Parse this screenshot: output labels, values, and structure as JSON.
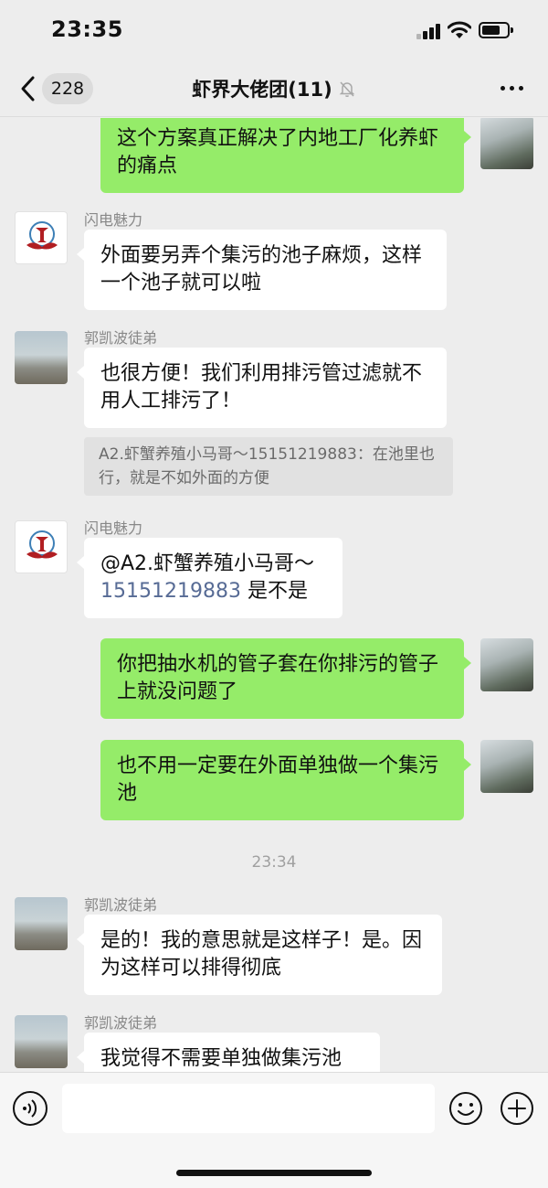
{
  "status_bar": {
    "time": "23:35"
  },
  "nav": {
    "unread_count": "228",
    "title": "虾界大佬团(11)"
  },
  "messages": [
    {
      "direction": "out",
      "text": "这个方案真正解决了内地工厂化养虾的痛点"
    },
    {
      "direction": "in",
      "sender": "闪电魅力",
      "text": "外面要另弄个集污的池子麻烦，这样一个池子就可以啦"
    },
    {
      "direction": "in",
      "sender": "郭凯波徒弟",
      "text": "也很方便！我们利用排污管过滤就不用人工排污了！",
      "quote": "A2.虾蟹养殖小马哥～15151219883：在池里也行，就是不如外面的方便"
    },
    {
      "direction": "in",
      "sender": "闪电魅力",
      "text_prefix": "@A2.虾蟹养殖小马哥～",
      "text_number": "15151219883",
      "text_suffix": " 是不是"
    },
    {
      "direction": "out",
      "text": "你把抽水机的管子套在你排污的管子上就没问题了"
    },
    {
      "direction": "out",
      "text": "也不用一定要在外面单独做一个集污池"
    },
    {
      "divider": "23:34"
    },
    {
      "direction": "in",
      "sender": "郭凯波徒弟",
      "text": "是的！我的意思就是这样子！是。因为这样可以排得彻底"
    },
    {
      "direction": "in",
      "sender": "郭凯波徒弟",
      "text": "我觉得不需要单独做集污池"
    }
  ],
  "icons": {
    "back": "chevron-left-icon",
    "mute": "bell-off-icon",
    "more": "more-dots-icon",
    "voice": "voice-icon",
    "emoji": "emoji-icon",
    "plus": "plus-icon"
  },
  "colors": {
    "outgoing_bubble": "#95ec69",
    "incoming_bubble": "#ffffff",
    "background": "#ededed",
    "mention_number": "#576b95"
  }
}
